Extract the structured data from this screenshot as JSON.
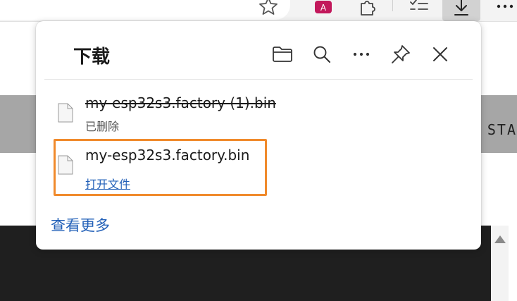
{
  "flyout": {
    "title": "下载",
    "items": [
      {
        "file_name": "my-esp32s3.factory (1).bin",
        "status": "已删除",
        "deleted": true
      },
      {
        "file_name": "my-esp32s3.factory.bin",
        "action": "打开文件",
        "deleted": false
      }
    ],
    "see_more": "查看更多"
  },
  "page_background": {
    "partial_text": "STA"
  },
  "colors": {
    "accent_link": "#2260b8",
    "highlight": "#f08a2c",
    "downloads_button_active": "#d2d2d2"
  },
  "icons": {
    "toolbar": [
      "star-icon",
      "translate-icon",
      "extensions-icon",
      "collections-icon",
      "download-icon",
      "more-icon"
    ],
    "flyout_header": [
      "open-folder-icon",
      "search-icon",
      "more-options-icon",
      "pin-icon",
      "close-icon"
    ],
    "file": "file-icon"
  }
}
